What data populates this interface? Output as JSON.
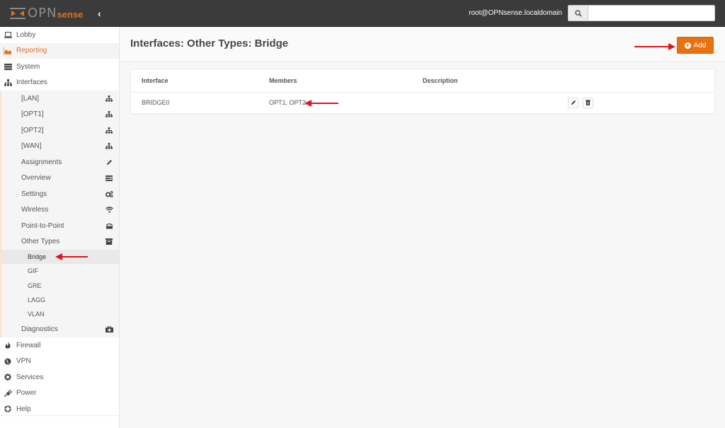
{
  "brand": {
    "part1": "OPN",
    "part2": "sense",
    "accent_color": "#e86f19"
  },
  "navbar": {
    "collapse_icon": "chevron-left-icon",
    "collapse_glyph": "‹",
    "user": "root@OPNsense.localdomain",
    "search": {
      "icon": "search-icon",
      "value": "",
      "placeholder": ""
    }
  },
  "sidebar": {
    "top_items": [
      {
        "label": "Lobby",
        "icon": "laptop-icon"
      },
      {
        "label": "Reporting",
        "icon": "area-chart-icon",
        "active": true
      },
      {
        "label": "System",
        "icon": "server-icon"
      },
      {
        "label": "Interfaces",
        "icon": "sitemap-icon"
      }
    ],
    "interfaces_items": [
      {
        "label": "[LAN]",
        "icon": "sitemap-icon"
      },
      {
        "label": "[OPT1]",
        "icon": "sitemap-icon"
      },
      {
        "label": "[OPT2]",
        "icon": "sitemap-icon"
      },
      {
        "label": "[WAN]",
        "icon": "sitemap-icon"
      },
      {
        "label": "Assignments",
        "icon": "pencil-icon"
      },
      {
        "label": "Overview",
        "icon": "list-icon"
      },
      {
        "label": "Settings",
        "icon": "cogs-icon"
      },
      {
        "label": "Wireless",
        "icon": "wifi-icon"
      },
      {
        "label": "Point-to-Point",
        "icon": "modem-icon"
      },
      {
        "label": "Other Types",
        "icon": "archive-icon"
      }
    ],
    "other_types_items": [
      {
        "label": "Bridge",
        "selected": true
      },
      {
        "label": "GIF"
      },
      {
        "label": "GRE"
      },
      {
        "label": "LAGG"
      },
      {
        "label": "VLAN"
      }
    ],
    "diagnostics": {
      "label": "Diagnostics",
      "icon": "medkit-icon"
    },
    "bottom_items": [
      {
        "label": "Firewall",
        "icon": "fire-icon"
      },
      {
        "label": "VPN",
        "icon": "globe-icon"
      },
      {
        "label": "Services",
        "icon": "cog-icon"
      },
      {
        "label": "Power",
        "icon": "plug-icon"
      },
      {
        "label": "Help",
        "icon": "life-ring-icon"
      }
    ]
  },
  "main": {
    "title": "Interfaces: Other Types: Bridge",
    "add_button": {
      "label": "Add",
      "icon": "plus-circle-icon",
      "color": "#e8720f"
    },
    "table": {
      "columns": [
        "Interface",
        "Members",
        "Description",
        ""
      ],
      "rows": [
        {
          "interface": "BRIDGE0",
          "members": "OPT1, OPT2",
          "description": "",
          "actions": [
            "edit",
            "delete"
          ]
        }
      ]
    }
  },
  "annotations": {
    "arrow_color": "#e0141b"
  }
}
